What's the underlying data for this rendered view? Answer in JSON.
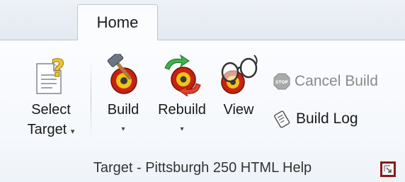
{
  "tabs": [
    {
      "label": "Home"
    }
  ],
  "group": {
    "label": "Target - Pittsburgh 250 HTML Help",
    "buttons": {
      "select_target": {
        "line1": "Select",
        "line2": "Target",
        "dropdown": "▾"
      },
      "build": {
        "label": "Build",
        "dropdown": "▾"
      },
      "rebuild": {
        "label": "Rebuild",
        "dropdown": "▾"
      },
      "view": {
        "label": "View"
      },
      "cancel_build": {
        "label": "Cancel Build",
        "enabled": false
      },
      "build_log": {
        "label": "Build Log"
      }
    }
  },
  "colors": {
    "launcher_highlight": "#8b1a1a",
    "tab_border": "#b8c7d9",
    "disabled_text": "#8a8a8a"
  },
  "icons": [
    "document-question-icon",
    "hammer-target-icon",
    "rebuild-arrows-icon",
    "glasses-target-icon",
    "stop-icon",
    "build-log-icon",
    "dialog-launcher-icon"
  ]
}
